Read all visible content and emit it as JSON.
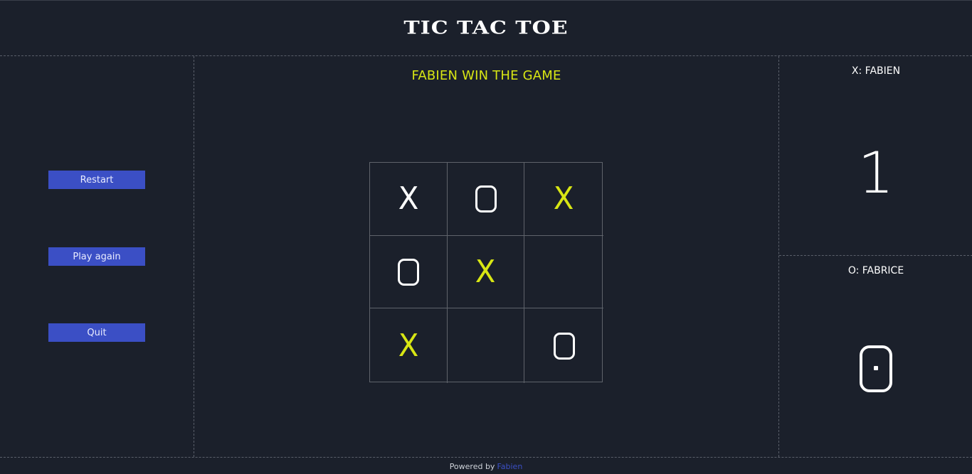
{
  "header": {
    "title": "TIC TAC TOE"
  },
  "controls": {
    "restart_label": "Restart",
    "play_again_label": "Play again",
    "quit_label": "Quit"
  },
  "game": {
    "status": "FABIEN WIN THE GAME",
    "board": [
      {
        "mark": "X",
        "winning": false
      },
      {
        "mark": "O",
        "winning": false
      },
      {
        "mark": "X",
        "winning": true
      },
      {
        "mark": "O",
        "winning": false
      },
      {
        "mark": "X",
        "winning": true
      },
      {
        "mark": "",
        "winning": false
      },
      {
        "mark": "X",
        "winning": true
      },
      {
        "mark": "",
        "winning": false
      },
      {
        "mark": "O",
        "winning": false
      }
    ],
    "win_color": "#d8e614"
  },
  "scores": {
    "x": {
      "label": "X: FABIEN",
      "value": "1"
    },
    "o": {
      "label": "O: FABRICE",
      "value": "0"
    }
  },
  "footer": {
    "prefix": "Powered by",
    "link": "Fabien"
  },
  "colors": {
    "background": "#1b202b",
    "button": "#3b4fc5",
    "accent": "#d8e614"
  }
}
